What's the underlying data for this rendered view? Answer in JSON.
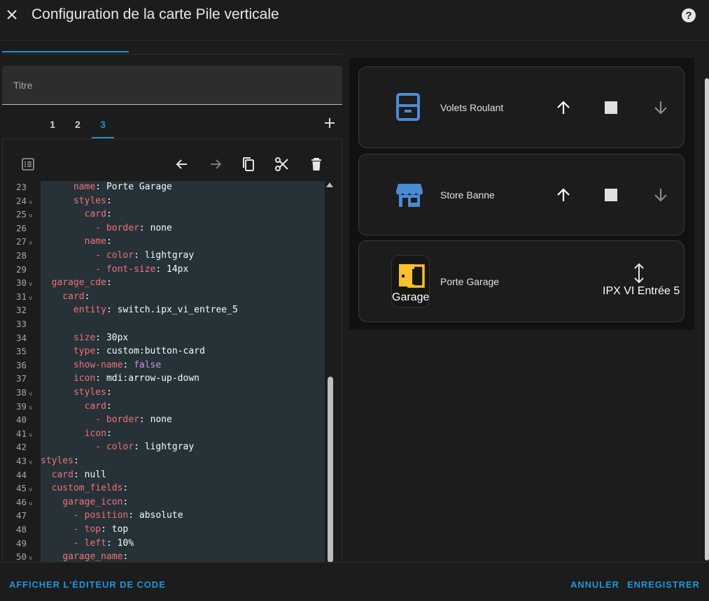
{
  "dialog": {
    "title": "Configuration de la carte Pile verticale"
  },
  "form": {
    "title_placeholder": "Titre"
  },
  "card_tabs": [
    "1",
    "2",
    "3"
  ],
  "active_card_tab": "3",
  "code_lines": [
    {
      "n": "23",
      "fold": false,
      "indent": 6,
      "key": "name",
      "val": "Porte Garage"
    },
    {
      "n": "24",
      "fold": true,
      "indent": 6,
      "key": "styles",
      "val": ""
    },
    {
      "n": "25",
      "fold": true,
      "indent": 8,
      "key": "card",
      "val": ""
    },
    {
      "n": "26",
      "fold": false,
      "indent": 10,
      "key": "- border",
      "val": "none"
    },
    {
      "n": "27",
      "fold": true,
      "indent": 8,
      "key": "name",
      "val": ""
    },
    {
      "n": "28",
      "fold": false,
      "indent": 10,
      "key": "- color",
      "val": "lightgray"
    },
    {
      "n": "29",
      "fold": false,
      "indent": 10,
      "key": "- font-size",
      "val": "14px"
    },
    {
      "n": "30",
      "fold": true,
      "indent": 2,
      "key": "garage_cde",
      "val": ""
    },
    {
      "n": "31",
      "fold": true,
      "indent": 4,
      "key": "card",
      "val": ""
    },
    {
      "n": "32",
      "fold": false,
      "indent": 6,
      "key": "entity",
      "val": "switch.ipx_vi_entree_5"
    },
    {
      "n": "33",
      "fold": false,
      "indent": 0,
      "key": "",
      "val": ""
    },
    {
      "n": "34",
      "fold": false,
      "indent": 6,
      "key": "size",
      "val": "30px"
    },
    {
      "n": "35",
      "fold": false,
      "indent": 6,
      "key": "type",
      "val": "custom:button-card"
    },
    {
      "n": "36",
      "fold": false,
      "indent": 6,
      "key": "show-name",
      "val": "false",
      "bool": true
    },
    {
      "n": "37",
      "fold": false,
      "indent": 6,
      "key": "icon",
      "val": "mdi:arrow-up-down"
    },
    {
      "n": "38",
      "fold": true,
      "indent": 6,
      "key": "styles",
      "val": ""
    },
    {
      "n": "39",
      "fold": true,
      "indent": 8,
      "key": "card",
      "val": ""
    },
    {
      "n": "40",
      "fold": false,
      "indent": 10,
      "key": "- border",
      "val": "none"
    },
    {
      "n": "41",
      "fold": true,
      "indent": 8,
      "key": "icon",
      "val": ""
    },
    {
      "n": "42",
      "fold": false,
      "indent": 10,
      "key": "- color",
      "val": "lightgray"
    },
    {
      "n": "43",
      "fold": true,
      "indent": 0,
      "key": "styles",
      "val": ""
    },
    {
      "n": "44",
      "fold": false,
      "indent": 2,
      "key": "card",
      "val": "null"
    },
    {
      "n": "45",
      "fold": true,
      "indent": 2,
      "key": "custom_fields",
      "val": ""
    },
    {
      "n": "46",
      "fold": true,
      "indent": 4,
      "key": "garage_icon",
      "val": ""
    },
    {
      "n": "47",
      "fold": false,
      "indent": 6,
      "key": "- position",
      "val": "absolute"
    },
    {
      "n": "48",
      "fold": false,
      "indent": 6,
      "key": "- top",
      "val": "top"
    },
    {
      "n": "49",
      "fold": false,
      "indent": 6,
      "key": "- left",
      "val": "10%"
    },
    {
      "n": "50",
      "fold": true,
      "indent": 4,
      "key": "garage_name",
      "val": ""
    }
  ],
  "preview": {
    "card1": {
      "name": "Volets Roulant",
      "icon": "window-shutter-icon"
    },
    "card2": {
      "name": "Store Banne",
      "icon": "storefront-icon"
    },
    "card3": {
      "name": "Porte Garage",
      "tile_label": "Garage",
      "state": "IPX VI Entrée 5",
      "icon": "garage-door-icon",
      "icon_color": "#fbc02d"
    }
  },
  "footer": {
    "show_code": "AFFICHER L'ÉDITEUR DE CODE",
    "cancel": "ANNULER",
    "save": "ENREGISTRER"
  },
  "colors": {
    "accent": "#1f8fd6",
    "cover_icon": "#4b8bd4",
    "garage_icon": "#fbc02d"
  }
}
